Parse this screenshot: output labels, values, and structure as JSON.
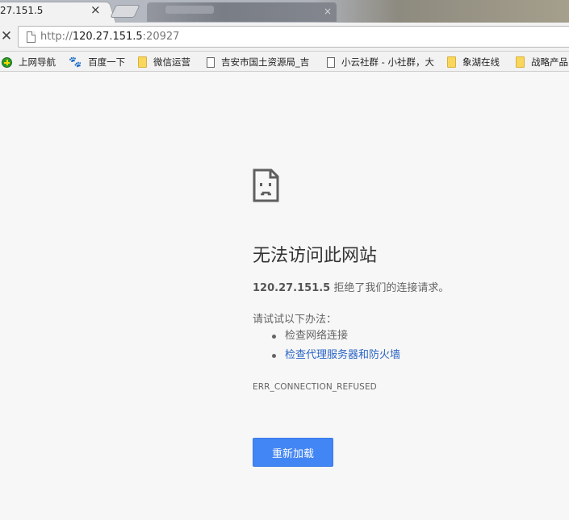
{
  "tabs": {
    "active_title": "27.151.5",
    "close_glyph": "×"
  },
  "toolbar": {
    "stop_glyph": "✕",
    "url_scheme": "http://",
    "url_host": "120.27.151.5",
    "url_port": ":20927"
  },
  "bookmarks": [
    {
      "label": "上网导航",
      "icon": "plus-circle-icon"
    },
    {
      "label": "百度一下",
      "icon": "baidu-paw-icon"
    },
    {
      "label": "微信运营",
      "icon": "folder-icon"
    },
    {
      "label": "吉安市国土资源局_吉",
      "icon": "page-icon"
    },
    {
      "label": "小云社群 - 小社群，大",
      "icon": "page-icon"
    },
    {
      "label": "象湖在线",
      "icon": "folder-icon"
    },
    {
      "label": "战略产品",
      "icon": "folder-icon"
    }
  ],
  "error": {
    "title": "无法访问此网站",
    "host": "120.27.151.5",
    "message": " 拒绝了我们的连接请求。",
    "try_heading": "请试试以下办法：",
    "suggestions": [
      "检查网络连接",
      "检查代理服务器和防火墙"
    ],
    "code": "ERR_CONNECTION_REFUSED",
    "reload_label": "重新加载"
  },
  "colors": {
    "accent": "#4285f4",
    "link": "#2a64c5",
    "background": "#f7f7f7"
  }
}
